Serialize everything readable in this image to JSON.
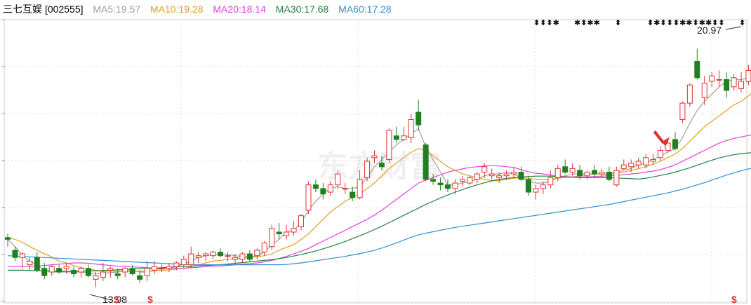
{
  "chart_data": {
    "type": "candlestick",
    "stock_name": "三七互娱",
    "stock_code": "[002555]",
    "ma_legend": [
      {
        "label": "MA5:19.57",
        "color": "#a0a0a0"
      },
      {
        "label": "MA10:19.28",
        "color": "#e0a020"
      },
      {
        "label": "MA20:18.14",
        "color": "#e040e0"
      },
      {
        "label": "MA30:17.68",
        "color": "#208040"
      },
      {
        "label": "MA60:17.28",
        "color": "#3090d0"
      }
    ],
    "ylim": [
      13.55,
      21.35
    ],
    "grid": true,
    "colors": {
      "up": "#e03030",
      "down": "#208020",
      "arrow": "#e03030"
    },
    "annotations": {
      "high_label": "20.97",
      "low_label": "13.98"
    },
    "watermark": "东方财富",
    "candles": [
      [
        15.35,
        15.45,
        15.1,
        15.3
      ],
      [
        15.0,
        15.1,
        14.7,
        14.8
      ],
      [
        14.8,
        14.95,
        14.5,
        14.9
      ],
      [
        14.6,
        14.8,
        14.45,
        14.7
      ],
      [
        14.8,
        14.95,
        14.4,
        14.45
      ],
      [
        14.5,
        14.65,
        14.2,
        14.3
      ],
      [
        14.4,
        14.6,
        14.3,
        14.55
      ],
      [
        14.5,
        14.6,
        14.35,
        14.4
      ],
      [
        14.5,
        14.65,
        14.35,
        14.55
      ],
      [
        14.45,
        14.55,
        14.25,
        14.35
      ],
      [
        14.4,
        14.55,
        14.25,
        14.5
      ],
      [
        14.5,
        14.6,
        14.25,
        14.3
      ],
      [
        14.2,
        14.4,
        13.98,
        14.3
      ],
      [
        14.25,
        14.65,
        14.15,
        14.4
      ],
      [
        14.45,
        14.55,
        14.25,
        14.5
      ],
      [
        14.35,
        14.5,
        14.2,
        14.3
      ],
      [
        14.4,
        14.55,
        14.25,
        14.5
      ],
      [
        14.5,
        14.6,
        14.3,
        14.35
      ],
      [
        14.3,
        14.45,
        14.1,
        14.2
      ],
      [
        14.3,
        14.7,
        14.15,
        14.5
      ],
      [
        14.45,
        14.7,
        14.35,
        14.55
      ],
      [
        14.5,
        14.6,
        14.4,
        14.5
      ],
      [
        14.5,
        14.65,
        14.4,
        14.55
      ],
      [
        14.55,
        14.7,
        14.45,
        14.65
      ],
      [
        14.6,
        14.85,
        14.5,
        14.75
      ],
      [
        14.6,
        15.1,
        14.5,
        14.9
      ],
      [
        14.8,
        14.95,
        14.65,
        14.85
      ],
      [
        14.85,
        14.95,
        14.7,
        14.9
      ],
      [
        14.85,
        15.0,
        14.75,
        14.95
      ],
      [
        14.95,
        15.05,
        14.8,
        14.85
      ],
      [
        14.85,
        14.95,
        14.7,
        14.85
      ],
      [
        14.75,
        14.9,
        14.6,
        14.8
      ],
      [
        14.75,
        14.95,
        14.65,
        14.9
      ],
      [
        14.9,
        15.0,
        14.7,
        14.75
      ],
      [
        14.85,
        15.05,
        14.75,
        15.0
      ],
      [
        14.95,
        15.25,
        14.85,
        15.2
      ],
      [
        15.1,
        15.7,
        15.0,
        15.6
      ],
      [
        15.5,
        15.75,
        15.3,
        15.45
      ],
      [
        15.4,
        15.7,
        15.3,
        15.5
      ],
      [
        15.5,
        15.8,
        15.4,
        15.6
      ],
      [
        15.65,
        16.0,
        15.55,
        15.95
      ],
      [
        16.1,
        16.9,
        16.0,
        16.8
      ],
      [
        16.8,
        16.95,
        16.6,
        16.7
      ],
      [
        16.7,
        16.85,
        16.4,
        16.55
      ],
      [
        16.6,
        16.9,
        16.5,
        16.8
      ],
      [
        16.8,
        17.2,
        16.7,
        17.1
      ],
      [
        16.7,
        16.85,
        16.55,
        16.7
      ],
      [
        16.6,
        16.75,
        16.35,
        16.45
      ],
      [
        16.45,
        17.2,
        16.4,
        16.95
      ],
      [
        17.0,
        17.55,
        16.9,
        17.45
      ],
      [
        17.55,
        17.75,
        17.4,
        17.6
      ],
      [
        17.4,
        17.6,
        17.2,
        17.3
      ],
      [
        17.5,
        18.35,
        17.4,
        18.3
      ],
      [
        18.15,
        18.4,
        17.95,
        18.05
      ],
      [
        18.05,
        18.4,
        18.0,
        18.15
      ],
      [
        18.1,
        18.75,
        17.95,
        18.6
      ],
      [
        18.8,
        19.15,
        18.3,
        18.45
      ],
      [
        17.9,
        17.95,
        16.9,
        16.95
      ],
      [
        16.95,
        17.1,
        16.8,
        16.9
      ],
      [
        16.85,
        17.0,
        16.65,
        16.8
      ],
      [
        16.8,
        16.95,
        16.6,
        16.7
      ],
      [
        16.7,
        16.95,
        16.55,
        16.85
      ],
      [
        16.9,
        17.05,
        16.75,
        16.95
      ],
      [
        16.85,
        17.05,
        16.8,
        17.0
      ],
      [
        16.95,
        17.15,
        16.85,
        17.1
      ],
      [
        17.15,
        17.4,
        17.0,
        17.3
      ],
      [
        17.05,
        17.25,
        16.95,
        17.1
      ],
      [
        17.0,
        17.15,
        16.85,
        17.05
      ],
      [
        17.05,
        17.2,
        16.95,
        17.1
      ],
      [
        17.1,
        17.3,
        17.0,
        17.15
      ],
      [
        17.15,
        17.3,
        16.9,
        16.95
      ],
      [
        16.95,
        17.05,
        16.5,
        16.6
      ],
      [
        16.6,
        16.8,
        16.4,
        16.7
      ],
      [
        16.7,
        16.9,
        16.55,
        16.8
      ],
      [
        16.8,
        17.2,
        16.7,
        17.0
      ],
      [
        17.0,
        17.35,
        16.9,
        17.25
      ],
      [
        17.3,
        17.5,
        17.1,
        17.15
      ],
      [
        17.15,
        17.4,
        17.05,
        17.25
      ],
      [
        17.2,
        17.35,
        16.95,
        17.05
      ],
      [
        17.05,
        17.2,
        16.95,
        17.15
      ],
      [
        17.2,
        17.35,
        17.0,
        17.1
      ],
      [
        17.1,
        17.25,
        17.0,
        17.15
      ],
      [
        17.15,
        17.3,
        16.9,
        16.95
      ],
      [
        16.8,
        17.3,
        16.75,
        17.2
      ],
      [
        17.25,
        17.5,
        17.2,
        17.35
      ],
      [
        17.3,
        17.5,
        17.15,
        17.4
      ],
      [
        17.35,
        17.55,
        17.25,
        17.45
      ],
      [
        17.35,
        17.65,
        17.25,
        17.55
      ],
      [
        17.45,
        17.65,
        17.35,
        17.5
      ],
      [
        17.55,
        17.85,
        17.45,
        17.75
      ],
      [
        17.75,
        18.05,
        17.7,
        17.95
      ],
      [
        18.05,
        18.25,
        17.75,
        17.8
      ],
      [
        18.6,
        19.1,
        18.5,
        19.05
      ],
      [
        19.05,
        19.6,
        18.95,
        19.55
      ],
      [
        20.2,
        20.55,
        19.7,
        19.75
      ],
      [
        19.2,
        19.8,
        19.0,
        19.6
      ],
      [
        19.65,
        19.9,
        19.5,
        19.8
      ],
      [
        19.7,
        19.95,
        19.5,
        19.7
      ],
      [
        19.7,
        19.9,
        19.2,
        19.4
      ],
      [
        19.5,
        19.85,
        19.4,
        19.75
      ],
      [
        19.45,
        19.9,
        19.35,
        19.65
      ],
      [
        19.65,
        20.1,
        19.55,
        19.95
      ],
      [
        19.6,
        20.97,
        19.5,
        20.3
      ]
    ],
    "ma": {
      "ma5": [
        15.3,
        15.1,
        14.85,
        14.7,
        14.6,
        14.45,
        14.4,
        14.4,
        14.4,
        14.4,
        14.4,
        14.38,
        14.35,
        14.37,
        14.38,
        14.4,
        14.43,
        14.44,
        14.4,
        14.4,
        14.45,
        14.5,
        14.52,
        14.55,
        14.62,
        14.7,
        14.8,
        14.85,
        14.88,
        14.9,
        14.88,
        14.85,
        14.83,
        14.82,
        14.85,
        14.95,
        15.15,
        15.3,
        15.5,
        15.55,
        15.75,
        16.1,
        16.35,
        16.55,
        16.7,
        16.75,
        16.7,
        16.7,
        16.75,
        17.0,
        17.3,
        17.5,
        17.7,
        17.9,
        18.05,
        18.2,
        18.35,
        17.85,
        17.5,
        17.15,
        16.8,
        16.8,
        16.85,
        16.9,
        16.95,
        17.05,
        17.1,
        17.1,
        17.15,
        17.1,
        17.0,
        16.9,
        16.85,
        16.85,
        16.9,
        17.0,
        17.05,
        17.1,
        17.1,
        17.1,
        17.1,
        17.1,
        17.1,
        17.15,
        17.2,
        17.25,
        17.35,
        17.4,
        17.5,
        17.6,
        17.7,
        17.8,
        18.1,
        18.5,
        18.85,
        19.1,
        19.3,
        19.5,
        19.65,
        19.7,
        19.7,
        19.75,
        19.9
      ],
      "ma10": [
        15.35,
        15.3,
        15.22,
        15.1,
        15.0,
        14.9,
        14.82,
        14.7,
        14.65,
        14.58,
        14.52,
        14.48,
        14.45,
        14.43,
        14.42,
        14.42,
        14.42,
        14.42,
        14.42,
        14.42,
        14.43,
        14.44,
        14.46,
        14.48,
        14.5,
        14.55,
        14.6,
        14.65,
        14.7,
        14.72,
        14.75,
        14.77,
        14.79,
        14.8,
        14.82,
        14.85,
        14.9,
        15.0,
        15.08,
        15.15,
        15.3,
        15.45,
        15.65,
        15.85,
        16.05,
        16.2,
        16.35,
        16.45,
        16.55,
        16.7,
        16.85,
        17.05,
        17.25,
        17.4,
        17.55,
        17.7,
        17.8,
        17.75,
        17.6,
        17.45,
        17.3,
        17.2,
        17.1,
        17.05,
        17.0,
        16.95,
        16.92,
        16.92,
        16.95,
        16.98,
        17.0,
        16.98,
        16.95,
        16.95,
        16.95,
        16.98,
        17.0,
        17.02,
        17.05,
        17.08,
        17.1,
        17.1,
        17.1,
        17.12,
        17.15,
        17.2,
        17.25,
        17.3,
        17.37,
        17.45,
        17.55,
        17.65,
        17.8,
        18.0,
        18.2,
        18.4,
        18.55,
        18.7,
        18.85,
        19.0,
        19.1,
        19.25,
        19.45
      ],
      "ma20": [
        14.55,
        14.55,
        14.55,
        14.56,
        14.57,
        14.58,
        14.6,
        14.62,
        14.63,
        14.65,
        14.65,
        14.64,
        14.62,
        14.6,
        14.58,
        14.56,
        14.55,
        14.54,
        14.53,
        14.52,
        14.51,
        14.5,
        14.5,
        14.5,
        14.5,
        14.52,
        14.53,
        14.55,
        14.56,
        14.57,
        14.58,
        14.6,
        14.62,
        14.63,
        14.65,
        14.68,
        14.72,
        14.77,
        14.83,
        14.9,
        14.97,
        15.05,
        15.15,
        15.25,
        15.35,
        15.45,
        15.55,
        15.65,
        15.75,
        15.85,
        15.97,
        16.1,
        16.25,
        16.4,
        16.55,
        16.7,
        16.85,
        16.93,
        17.0,
        17.08,
        17.15,
        17.2,
        17.24,
        17.28,
        17.3,
        17.32,
        17.33,
        17.32,
        17.3,
        17.28,
        17.22,
        17.16,
        17.12,
        17.1,
        17.07,
        17.05,
        17.03,
        17.02,
        17.02,
        17.02,
        17.03,
        17.04,
        17.05,
        17.06,
        17.08,
        17.1,
        17.12,
        17.15,
        17.18,
        17.22,
        17.28,
        17.35,
        17.45,
        17.55,
        17.65,
        17.75,
        17.85,
        17.95,
        18.02,
        18.08,
        18.12,
        18.16,
        18.2
      ],
      "ma30": [
        14.45,
        14.45,
        14.45,
        14.44,
        14.44,
        14.43,
        14.43,
        14.42,
        14.42,
        14.42,
        14.42,
        14.43,
        14.43,
        14.44,
        14.45,
        14.46,
        14.47,
        14.48,
        14.49,
        14.5,
        14.51,
        14.52,
        14.53,
        14.54,
        14.55,
        14.56,
        14.57,
        14.58,
        14.59,
        14.6,
        14.62,
        14.64,
        14.66,
        14.68,
        14.7,
        14.72,
        14.74,
        14.77,
        14.8,
        14.84,
        14.88,
        14.93,
        14.98,
        15.04,
        15.1,
        15.17,
        15.24,
        15.32,
        15.4,
        15.48,
        15.57,
        15.66,
        15.76,
        15.86,
        15.96,
        16.06,
        16.16,
        16.26,
        16.35,
        16.44,
        16.52,
        16.6,
        16.67,
        16.74,
        16.8,
        16.86,
        16.91,
        16.95,
        16.98,
        17.0,
        17.02,
        17.03,
        17.04,
        17.04,
        17.04,
        17.03,
        17.02,
        17.01,
        17.0,
        17.0,
        17.0,
        17.0,
        17.0,
        16.99,
        16.98,
        16.97,
        16.96,
        16.98,
        17.02,
        17.06,
        17.1,
        17.15,
        17.21,
        17.27,
        17.34,
        17.41,
        17.48,
        17.54,
        17.59,
        17.63,
        17.66,
        17.68,
        17.69
      ],
      "ma60": [
        14.85,
        14.84,
        14.83,
        14.82,
        14.81,
        14.8,
        14.79,
        14.78,
        14.77,
        14.76,
        14.75,
        14.74,
        14.73,
        14.72,
        14.71,
        14.7,
        14.69,
        14.68,
        14.67,
        14.66,
        14.65,
        14.64,
        14.63,
        14.62,
        14.61,
        14.6,
        14.6,
        14.6,
        14.6,
        14.6,
        14.6,
        14.6,
        14.6,
        14.6,
        14.6,
        14.6,
        14.6,
        14.6,
        14.61,
        14.63,
        14.65,
        14.68,
        14.71,
        14.74,
        14.77,
        14.8,
        14.83,
        14.87,
        14.91,
        14.95,
        15.0,
        15.06,
        15.13,
        15.2,
        15.28,
        15.36,
        15.42,
        15.47,
        15.51,
        15.55,
        15.59,
        15.63,
        15.66,
        15.69,
        15.72,
        15.75,
        15.78,
        15.81,
        15.84,
        15.87,
        15.9,
        15.93,
        15.96,
        15.99,
        16.02,
        16.05,
        16.08,
        16.11,
        16.14,
        16.17,
        16.2,
        16.23,
        16.26,
        16.3,
        16.34,
        16.38,
        16.42,
        16.46,
        16.5,
        16.54,
        16.58,
        16.63,
        16.68,
        16.74,
        16.8,
        16.86,
        16.93,
        17.0,
        17.07,
        17.13,
        17.19,
        17.24,
        17.28
      ]
    }
  }
}
